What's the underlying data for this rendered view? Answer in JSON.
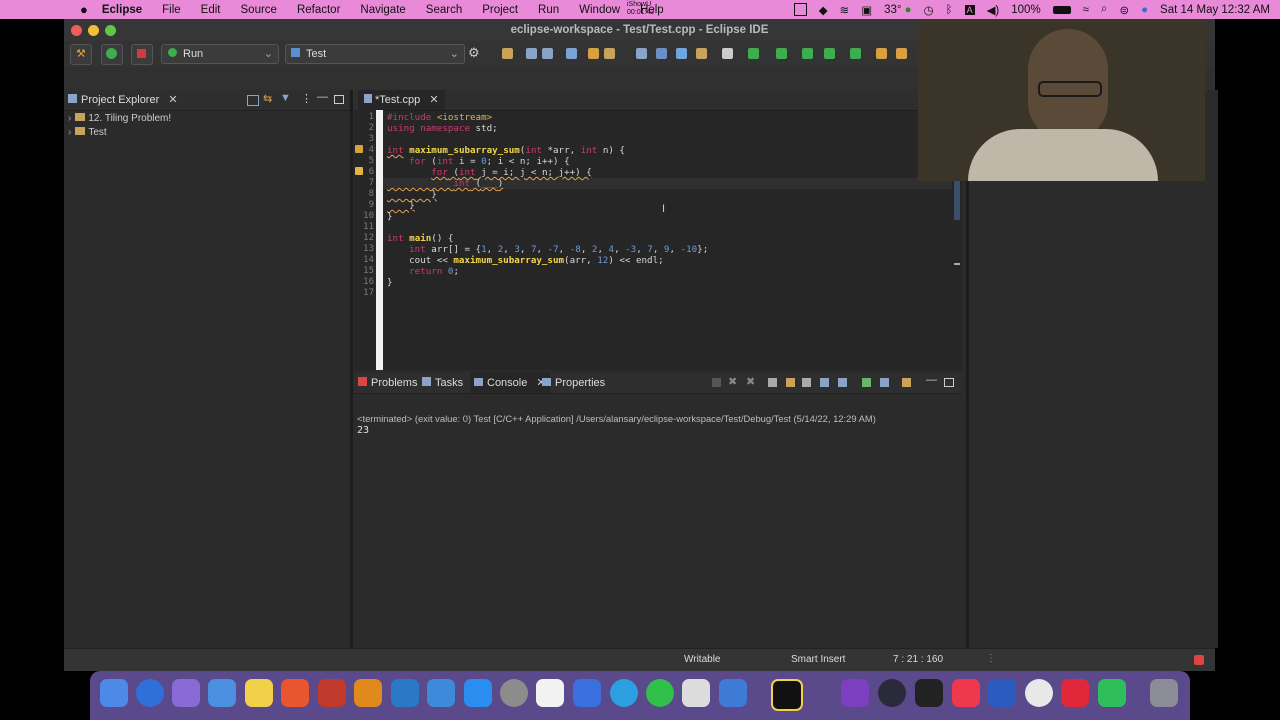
{
  "menubar": {
    "apple": "",
    "app": "Eclipse",
    "items": [
      "File",
      "Edit",
      "Source",
      "Refactor",
      "Navigate",
      "Search",
      "Project",
      "Run",
      "Window",
      "Help"
    ],
    "ishowu_label": "iShowU",
    "ishowu_time": "00:01:42",
    "temperature": "33°",
    "battery": "100%",
    "datetime": "Sat 14 May  12:32 AM"
  },
  "window": {
    "title": "eclipse-workspace - Test/Test.cpp - Eclipse IDE"
  },
  "toolbar": {
    "run_combo": "Run",
    "config_combo": "Test"
  },
  "project_explorer": {
    "title": "Project Explorer",
    "items": [
      {
        "label": "12. Tiling Problem!"
      },
      {
        "label": "Test"
      }
    ]
  },
  "editor": {
    "tab_label": "*Test.cpp",
    "line_numbers": [
      "1",
      "2",
      "3",
      "4",
      "5",
      "6",
      "7",
      "8",
      "9",
      "10",
      "11",
      "12",
      "13",
      "14",
      "15",
      "16",
      "17"
    ]
  },
  "bottom_panel": {
    "tabs": [
      "Problems",
      "Tasks",
      "Console",
      "Properties"
    ],
    "console_header": "<terminated> (exit value: 0) Test [C/C++ Application] /Users/alansary/eclipse-workspace/Test/Debug/Test (5/14/22, 12:29 AM)",
    "console_output": "23"
  },
  "statusbar": {
    "mode": "Writable",
    "insert": "Smart Insert",
    "position": "7 : 21 : 160"
  },
  "colors": {
    "menubar_bg": "#e98ad8",
    "window_bg": "#2b2b2b",
    "keyword": "#cc3b6b",
    "function": "#f0d64c",
    "number": "#6c9ede"
  }
}
